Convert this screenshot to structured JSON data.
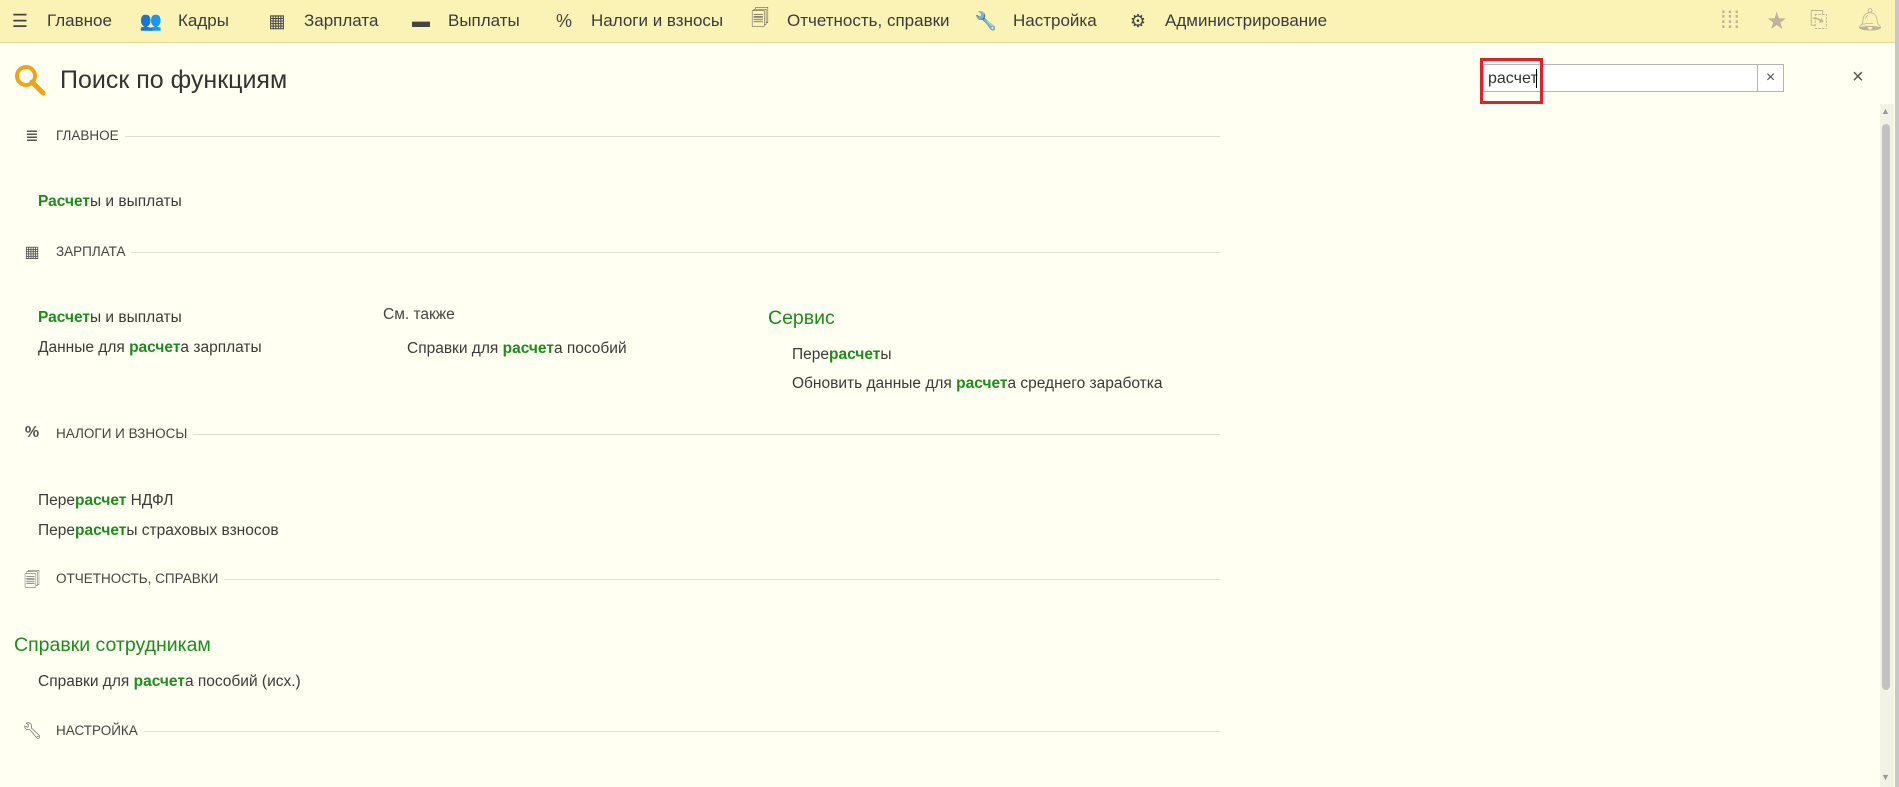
{
  "menu": [
    {
      "icon": "hamburger-icon",
      "glyph": "☰",
      "label": "Главное"
    },
    {
      "icon": "people-icon",
      "glyph": "👥",
      "label": "Кадры"
    },
    {
      "icon": "calculator-icon",
      "glyph": "▦",
      "label": "Зарплата"
    },
    {
      "icon": "wallet-icon",
      "glyph": "▬",
      "label": "Выплаты"
    },
    {
      "icon": "percent-icon",
      "glyph": "%",
      "label": "Налоги и взносы"
    },
    {
      "icon": "documents-icon",
      "glyph": "🗐",
      "label": "Отчетность, справки"
    },
    {
      "icon": "wrench-icon",
      "glyph": "🔧",
      "label": "Настройка"
    },
    {
      "icon": "gear-icon",
      "glyph": "⚙",
      "label": "Администрирование"
    }
  ],
  "toolbar_icons": [
    "apps-grid-icon",
    "star-icon",
    "history-icon",
    "bell-icon"
  ],
  "page": {
    "title": "Поиск по функциям"
  },
  "search": {
    "value": "расчет",
    "clear_label": "×"
  },
  "close_label": "×",
  "sections": {
    "main": {
      "label": "ГЛАВНОЕ",
      "icon": "hamburger-icon"
    },
    "salary": {
      "label": "ЗАРПЛАТА",
      "icon": "calculator-icon"
    },
    "taxes": {
      "label": "НАЛОГИ И ВЗНОСЫ",
      "icon": "percent-icon"
    },
    "reports": {
      "label": "ОТЧЕТНОСТЬ, СПРАВКИ",
      "icon": "documents-icon"
    },
    "settings": {
      "label": "НАСТРОЙКА",
      "icon": "wrench-icon"
    }
  },
  "links": {
    "main_calc": {
      "pre": "",
      "hl": "Расчет",
      "post": "ы и выплаты"
    },
    "salary_calc": {
      "pre": "",
      "hl": "Расчет",
      "post": "ы и выплаты"
    },
    "salary_data": {
      "pre": "Данные для ",
      "hl": "расчет",
      "post": "а зарплаты"
    },
    "see_also_label": "См. также",
    "see_also_ref": {
      "pre": "Справки для ",
      "hl": "расчет",
      "post": "а пособий"
    },
    "service_title": "Сервис",
    "service_recalc": {
      "pre": "Пере",
      "hl": "расчет",
      "post": "ы"
    },
    "service_update": {
      "pre": "Обновить данные для ",
      "hl": "расчет",
      "post": "а среднего заработка"
    },
    "taxes_ndfl": {
      "pre": "Пере",
      "hl": "расчет",
      "post": " НДФЛ"
    },
    "taxes_ins": {
      "pre": "Пере",
      "hl": "расчет",
      "post": "ы страховых взносов"
    },
    "reports_group_title": "Справки сотрудникам",
    "reports_ref": {
      "pre": "Справки для ",
      "hl": "расчет",
      "post": "а пособий (исх.)"
    }
  },
  "colors": {
    "accent": "#1d8c1d",
    "topbar": "#fbf3b5",
    "background": "#fffff2",
    "highlight_box": "#e0202a"
  }
}
